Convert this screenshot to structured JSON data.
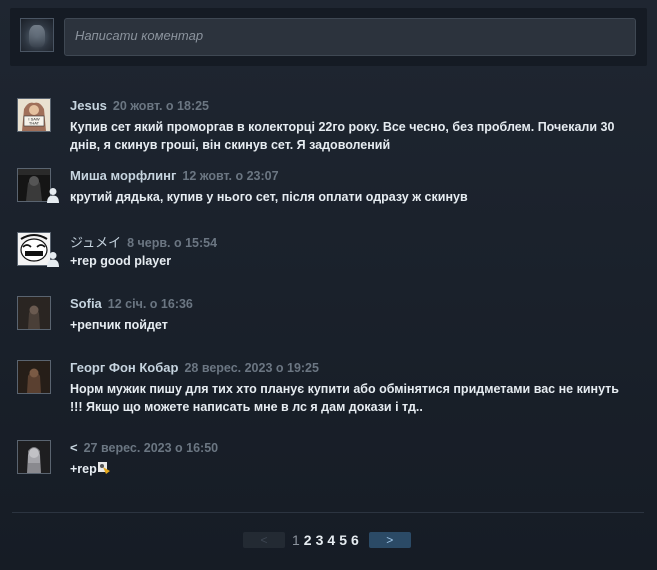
{
  "composer": {
    "placeholder": "Написати коментар"
  },
  "comments": [
    {
      "author": "Jesus",
      "time": "20 жовт. о 18:25",
      "text": "Купив сет який проморгав в колекторці 22го року. Все чесно, без проблем. Почекали 30 днів, я скинув гроші, він скинув сет. Я задоволений",
      "avatar": "i-saw-that"
    },
    {
      "author": "Миша морфлинг",
      "time": "12 жовт. о 23:07",
      "text": "крутий дядька, купив у нього сет, після оплати одразу ж скинув",
      "avatar": "dark-figure"
    },
    {
      "author": "ジュメイ",
      "time": "8 черв. о 15:54",
      "text": "+rep good player",
      "avatar": "meme-face"
    },
    {
      "author": "Sofia",
      "time": "12 січ. о 16:36",
      "text": "+репчик пойдет",
      "avatar": "dark-portrait"
    },
    {
      "author": "Георг Фон Кобар",
      "time": "28 верес. 2023 о 19:25",
      "text": "Норм мужик пишу для тих хто планує купити або обмінятися придметами вас не кинуть !!! Якщо що можете написать мне в лс я дам докази і тд..",
      "avatar": "brown-figure"
    },
    {
      "author": "<",
      "time": "27 верес. 2023 о 16:50",
      "text": "+rep",
      "avatar": "anime-figure"
    }
  ],
  "pagination": {
    "prev": "<",
    "next": ">",
    "pages": [
      "1",
      "2",
      "3",
      "4",
      "5",
      "6"
    ],
    "current": "1"
  },
  "colors": {
    "accent": "#2b4a66",
    "muted": "#6b7682"
  }
}
